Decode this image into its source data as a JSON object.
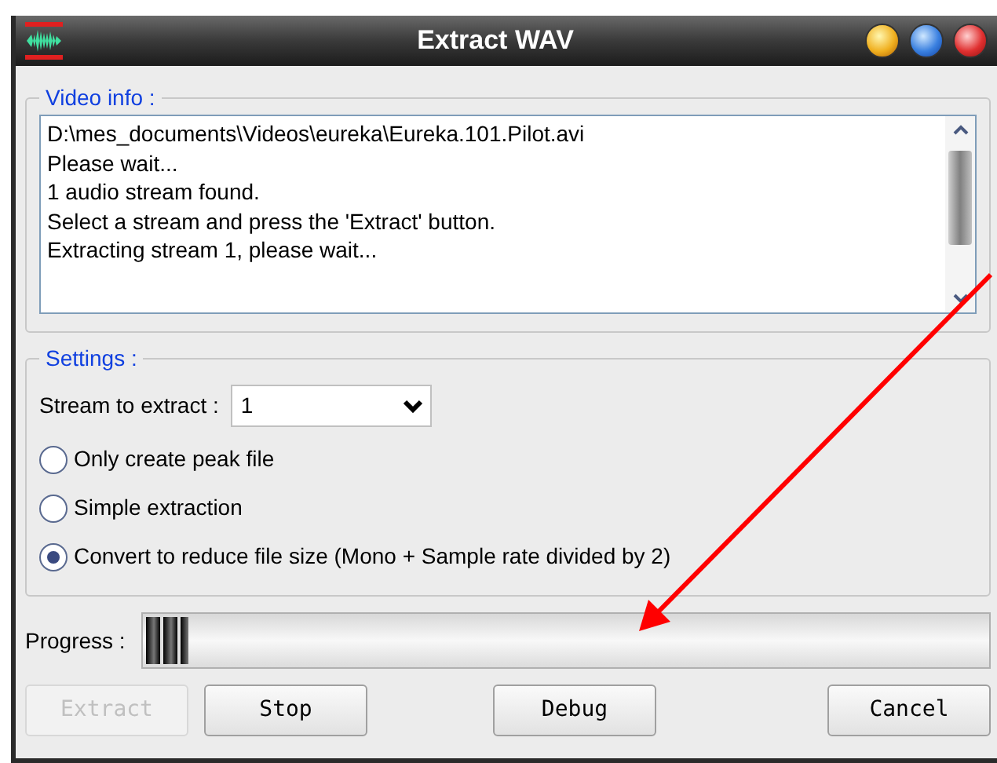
{
  "window": {
    "title": "Extract WAV"
  },
  "video_info": {
    "label": "Video info :",
    "lines": [
      "D:\\mes_documents\\Videos\\eureka\\Eureka.101.Pilot.avi",
      "Please wait...",
      "1 audio stream found.",
      "Select a stream and press the 'Extract' button.",
      "Extracting stream 1, please wait..."
    ]
  },
  "settings": {
    "label": "Settings :",
    "stream_label": "Stream to extract :",
    "stream_value": "1",
    "options": [
      {
        "label": "Only create peak file",
        "selected": false
      },
      {
        "label": "Simple extraction",
        "selected": false
      },
      {
        "label": "Convert to reduce file size (Mono + Sample rate divided by 2)",
        "selected": true
      }
    ]
  },
  "progress": {
    "label": "Progress :",
    "level": 0.05
  },
  "buttons": [
    {
      "label": "Extract",
      "disabled": true
    },
    {
      "label": "Stop",
      "disabled": false
    },
    {
      "label": "Debug",
      "disabled": false
    },
    {
      "label": "Cancel",
      "disabled": false
    }
  ]
}
